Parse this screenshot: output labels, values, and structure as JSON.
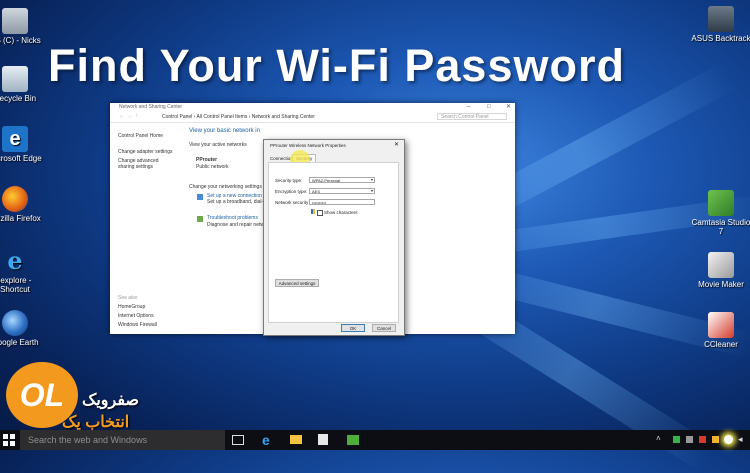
{
  "title": "Find Your Wi-Fi Password",
  "desktop_icons_left": [
    {
      "label": "OS (C) - Nicks",
      "icon": "drive-icon"
    },
    {
      "label": "Recycle Bin",
      "icon": "recycle-bin-icon"
    },
    {
      "label": "Microsoft Edge",
      "icon": "edge-icon"
    },
    {
      "label": "Mozilla Firefox",
      "icon": "firefox-icon"
    },
    {
      "label": "iexplore - Shortcut",
      "icon": "internet-explorer-icon"
    },
    {
      "label": "Google Earth",
      "icon": "google-earth-icon"
    }
  ],
  "desktop_icons_right": [
    {
      "label": "ASUS Backtrack",
      "icon": "asus-icon"
    },
    {
      "label": "Camtasia Studio 7",
      "icon": "camtasia-icon"
    },
    {
      "label": "Movie Maker",
      "icon": "movie-maker-icon"
    },
    {
      "label": "CCleaner",
      "icon": "ccleaner-icon"
    }
  ],
  "network_window": {
    "title": "Network and Sharing Center",
    "breadcrumb": [
      "Control Panel",
      "All Control Panel Items",
      "Network and Sharing Center"
    ],
    "search_placeholder": "Search Control Panel",
    "left_links": [
      "Control Panel Home",
      "Change adapter settings",
      "Change advanced sharing settings"
    ],
    "see_also_label": "See also",
    "see_also": [
      "HomeGroup",
      "Internet Options",
      "Windows Firewall"
    ],
    "heading": "View your basic network in",
    "active_networks": "View your active networks",
    "network_name": "PProuter",
    "network_type": "Public network",
    "change_settings": "Change your networking settings",
    "setup_link": "Set up a new connection o",
    "setup_desc": "Set up a broadband, dial-up, o",
    "troubleshoot_link": "Troubleshoot problems",
    "troubleshoot_desc": "Diagnose and repair networ"
  },
  "dialog": {
    "title": "PProuter Wireless Network Properties",
    "tabs": [
      "Connection",
      "Security"
    ],
    "security_type_label": "Security type:",
    "security_type_value": "WPA2-Personal",
    "encryption_label": "Encryption type:",
    "encryption_value": "AES",
    "key_label": "Network security key",
    "key_value": "••••••••••",
    "show_characters": "Show characters",
    "advanced": "Advanced settings",
    "ok": "OK",
    "cancel": "Cancel"
  },
  "watermark": {
    "logo": "OL",
    "line1": "صفرویک",
    "line2": "انتخاب یک"
  },
  "taskbar": {
    "search_placeholder": "Search the web and Windows"
  },
  "colors": {
    "accent": "#1c5fa8",
    "highlight": "#f4e84a",
    "logo_orange": "#f39a1e"
  }
}
